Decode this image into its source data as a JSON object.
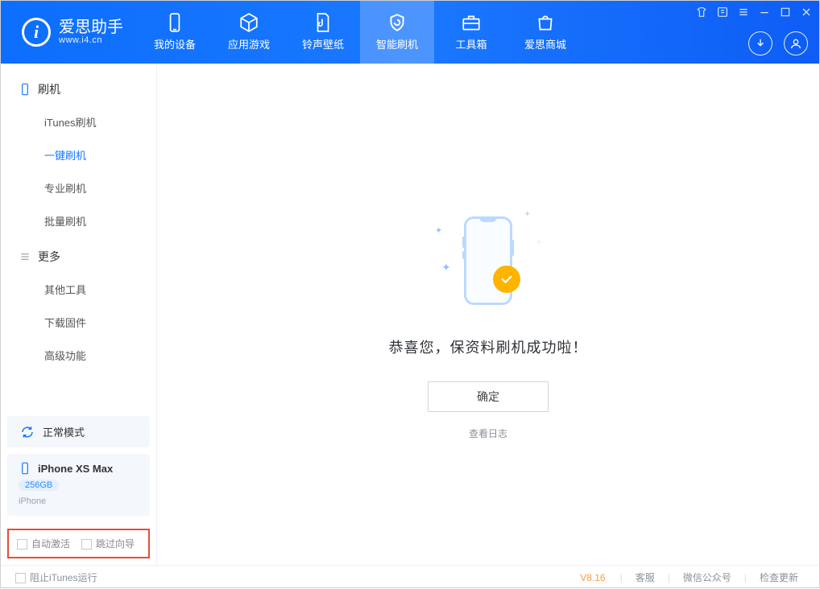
{
  "app": {
    "name": "爱思助手",
    "domain": "www.i4.cn"
  },
  "nav": {
    "my_device": "我的设备",
    "apps_games": "应用游戏",
    "ring_wall": "铃声壁纸",
    "smart_flash": "智能刷机",
    "toolbox": "工具箱",
    "store": "爱思商城"
  },
  "sidebar": {
    "group_flash": "刷机",
    "items_flash": {
      "itunes": "iTunes刷机",
      "oneclick": "一键刷机",
      "pro": "专业刷机",
      "batch": "批量刷机"
    },
    "group_more": "更多",
    "items_more": {
      "other_tools": "其他工具",
      "download_fw": "下载固件",
      "advanced": "高级功能"
    },
    "mode_normal": "正常模式",
    "device": {
      "name": "iPhone XS Max",
      "capacity": "256GB",
      "type": "iPhone"
    },
    "auto_activate": "自动激活",
    "skip_guide": "跳过向导"
  },
  "main": {
    "success": "恭喜您，保资料刷机成功啦！",
    "ok": "确定",
    "view_log": "查看日志"
  },
  "footer": {
    "block_itunes": "阻止iTunes运行",
    "version": "V8.16",
    "support": "客服",
    "wechat": "微信公众号",
    "update": "检查更新"
  }
}
